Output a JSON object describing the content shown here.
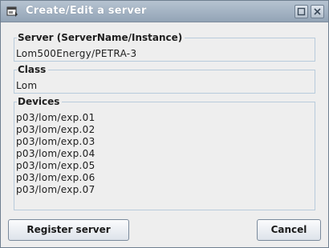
{
  "window": {
    "title": "Create/Edit a server"
  },
  "server": {
    "label": "Server  (ServerName/Instance)",
    "value": "Lom500Energy/PETRA-3"
  },
  "class": {
    "label": "Class",
    "value": "Lom"
  },
  "devices": {
    "label": "Devices",
    "items": [
      "p03/lom/exp.01",
      "p03/lom/exp.02",
      "p03/lom/exp.03",
      "p03/lom/exp.04",
      "p03/lom/exp.05",
      "p03/lom/exp.06",
      "p03/lom/exp.07"
    ]
  },
  "buttons": {
    "register": "Register server",
    "cancel": "Cancel"
  },
  "icons": {
    "app": "app-window-icon",
    "maximize": "maximize-icon",
    "close": "close-icon"
  },
  "colors": {
    "titlebar": "#a3b2c3",
    "border": "#b8cbdc",
    "background": "#eeeeee"
  }
}
